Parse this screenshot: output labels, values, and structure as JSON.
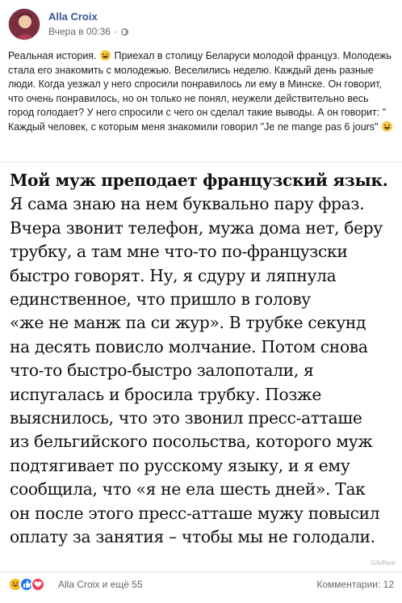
{
  "post": {
    "author": "Alla Croix",
    "time": "Вчера в 00:36",
    "separator": "·",
    "text_parts": [
      "Реальная история. ",
      " Приехал в столицу Беларуси молодой француз. Молодежь стала его знакомить с молодежью. Веселились неделю. Каждый день разные люди. Когда уезжал у него спросили понравилось ли ему в Минске. Он говорит, что очень понравилось, но он только не понял, неужели действительно весь город голодает? У него спросили с чего он сделал такие выводы. А он говорит: \" Каждый человек, с которым меня знакомили говорил \"Je ne mange pas 6 jours\" "
    ]
  },
  "image": {
    "lines": [
      "Мой муж преподает французский язык.",
      "Я сама знаю на нем буквально пару фраз.",
      "Вчера звонит телефон, мужа дома нет, беру",
      "трубку, а там мне что-то по-французски",
      "быстро говорят. Ну, я сдуру и ляпнула",
      "единственное, что пришло в голову",
      "«же не манж па си жур». В трубке секунд",
      "на десять повисло молчание. Потом снова",
      "что-то быстро-быстро залопотали, я",
      "испугалась и бросила трубку. Позже",
      "выяснилось, что это звонил пресс-атташе",
      "из бельгийского посольства, которого муж",
      "подтягивает по русскому языку, и я ему",
      "сообщила, что «я не ела шесть дней». Так",
      "он после этого пресс-атташе мужу повысил",
      "оплату за занятия – чтобы мы не голодали."
    ],
    "watermark": "©Adfave"
  },
  "footer": {
    "reactions_text": "Alla Croix и ещё 55",
    "comments_text": "Комментарии: 12"
  },
  "colors": {
    "author": "#385898",
    "meta": "#616770",
    "like": "#1877f2",
    "love": "#f33e58",
    "haha": "#f7b928"
  },
  "icons": [
    "avatar",
    "globe-icon",
    "grinning-emoji",
    "haha-reaction-icon",
    "like-reaction-icon",
    "love-reaction-icon"
  ]
}
